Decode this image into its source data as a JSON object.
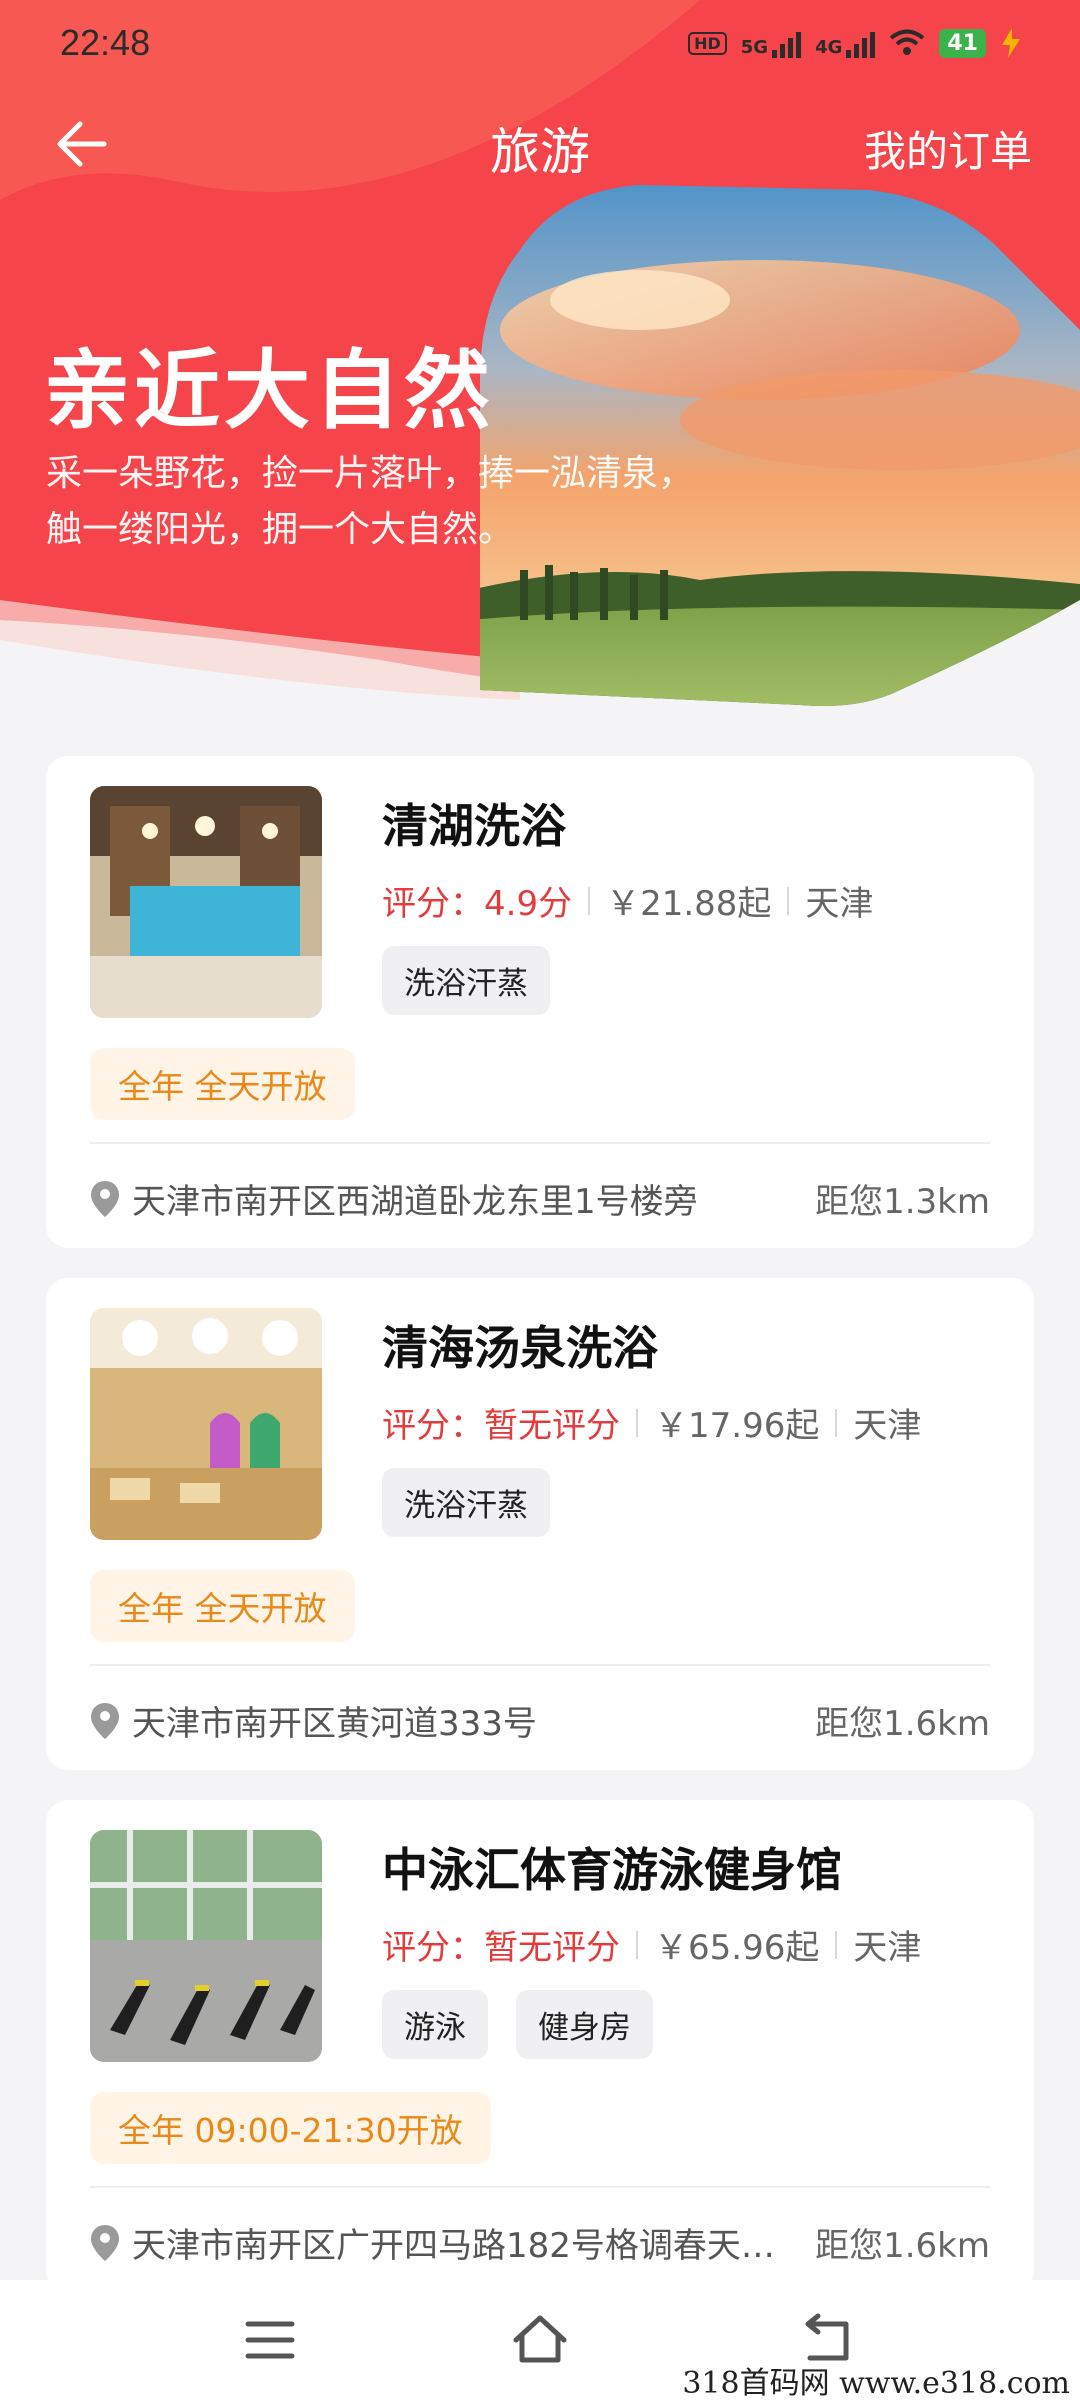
{
  "status_bar": {
    "time": "22:48",
    "network1": "5G",
    "network2": "4G",
    "battery": "41"
  },
  "nav": {
    "title": "旅游",
    "orders": "我的订单"
  },
  "hero": {
    "title": "亲近大自然",
    "subtitle_line1": "采一朵野花，捡一片落叶，捧一泓清泉，",
    "subtitle_line2": "触一缕阳光，拥一个大自然。"
  },
  "listings": [
    {
      "name": "清湖洗浴",
      "rating": "评分：4.9分",
      "price": "￥21.88起",
      "city": "天津",
      "tags": [
        "洗浴汗蒸"
      ],
      "open": "全年 全天开放",
      "address": "天津市南开区西湖道卧龙东里1号楼旁",
      "distance": "距您1.3km"
    },
    {
      "name": "清海汤泉洗浴",
      "rating": "评分：暂无评分",
      "price": "￥17.96起",
      "city": "天津",
      "tags": [
        "洗浴汗蒸"
      ],
      "open": "全年 全天开放",
      "address": "天津市南开区黄河道333号",
      "distance": "距您1.6km"
    },
    {
      "name": "中泳汇体育游泳健身馆",
      "rating": "评分：暂无评分",
      "price": "￥65.96起",
      "city": "天津",
      "tags": [
        "游泳",
        "健身房"
      ],
      "open": "全年 09:00-21:30开放",
      "address": "天津市南开区广开四马路182号格调春天…",
      "distance": "距您1.6km"
    }
  ],
  "watermark": "318首码网 www.e318.com",
  "colors": {
    "primary": "#f5454a",
    "rating": "#e23c3c",
    "open_text": "#e8891a",
    "open_bg": "#fff4e6"
  }
}
